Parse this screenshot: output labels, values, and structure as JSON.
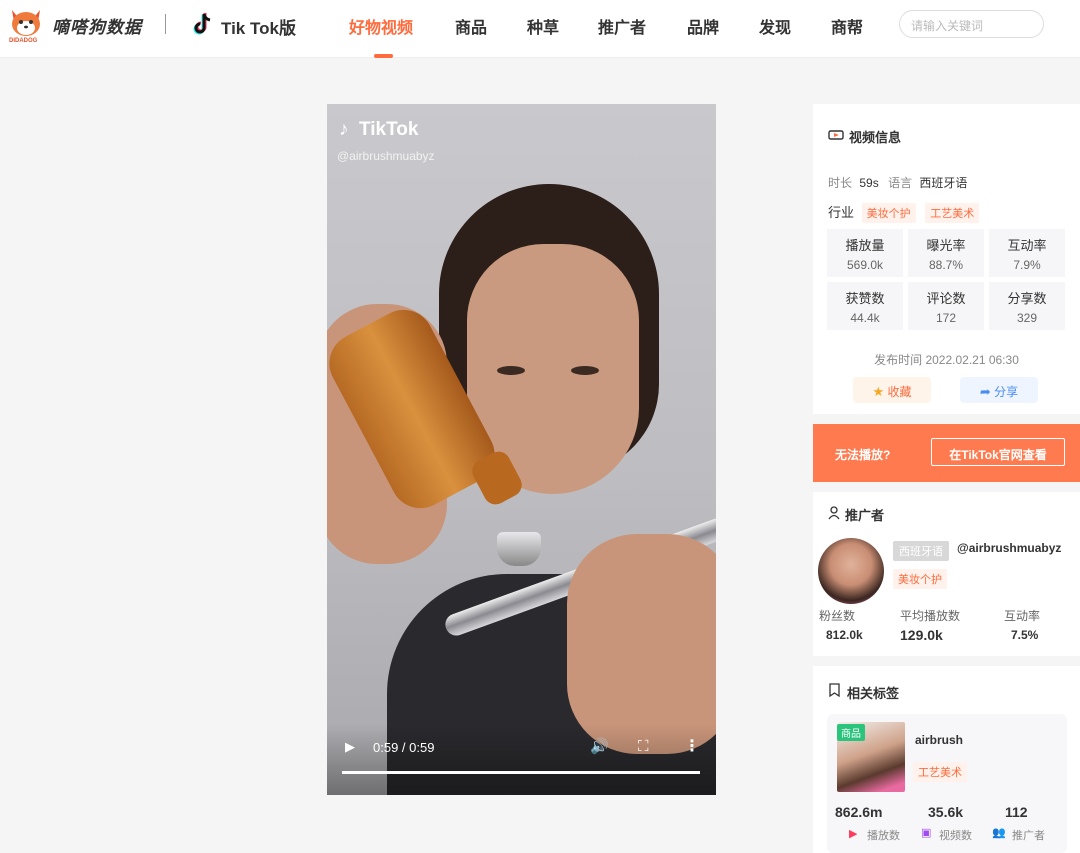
{
  "header": {
    "brand": "嘀嗒狗数据",
    "logo_caption": "DIDADOG",
    "platform": "Tik Tok版",
    "nav": [
      {
        "label": "好物视频",
        "active": true
      },
      {
        "label": "商品"
      },
      {
        "label": "种草"
      },
      {
        "label": "推广者"
      },
      {
        "label": "品牌"
      },
      {
        "label": "发现"
      },
      {
        "label": "商帮"
      }
    ],
    "search_placeholder": "请输入关键词",
    "accent_color": "#ff6b3d"
  },
  "video": {
    "watermark": "TikTok",
    "username": "@airbrushmuabyz",
    "time": "0:59 / 0:59",
    "progress": 1.0,
    "icons": [
      "play-icon",
      "volume-icon",
      "fullscreen-icon",
      "more-icon"
    ]
  },
  "video_info": {
    "title": "视频信息",
    "duration_label": "时长",
    "duration": "59s",
    "language_label": "语言",
    "language": "西班牙语",
    "industry_label": "行业",
    "industry_tags": [
      "美妆个护",
      "工艺美术"
    ],
    "stats": [
      {
        "label": "播放量",
        "value": "569.0k"
      },
      {
        "label": "曝光率",
        "value": "88.7%"
      },
      {
        "label": "互动率",
        "value": "7.9%"
      },
      {
        "label": "获赞数",
        "value": "44.4k"
      },
      {
        "label": "评论数",
        "value": "172"
      },
      {
        "label": "分享数",
        "value": "329"
      }
    ],
    "publish_time": "发布时间 2022.02.21 06:30",
    "favorite_label": "收藏",
    "share_label": "分享"
  },
  "cannot_play": {
    "text": "无法播放?",
    "button": "在TikTok官网查看"
  },
  "promoter": {
    "title": "推广者",
    "language_badge": "西班牙语",
    "handle": "@airbrushmuabyz",
    "tag": "美妆个护",
    "stats": [
      {
        "label": "粉丝数",
        "value": "812.0k"
      },
      {
        "label": "平均播放数",
        "value": "129.0k"
      },
      {
        "label": "互动率",
        "value": "7.5%"
      }
    ]
  },
  "related": {
    "title": "相关标签",
    "card": {
      "badge": "商品",
      "name": "airbrush",
      "tag": "工艺美术",
      "stats": [
        {
          "value": "862.6m",
          "label": "播放数"
        },
        {
          "value": "35.6k",
          "label": "视频数"
        },
        {
          "value": "112",
          "label": "推广者"
        }
      ]
    }
  }
}
